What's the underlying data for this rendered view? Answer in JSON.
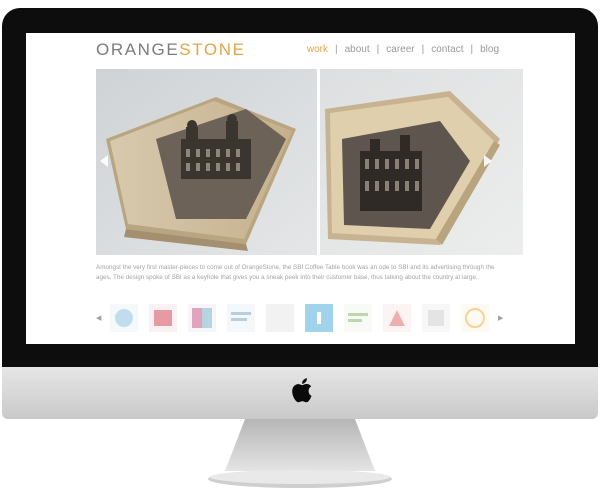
{
  "brand": {
    "part1": "ORANGE",
    "part2": "STONE",
    "accent_color": "#e0a64a"
  },
  "nav": {
    "items": [
      {
        "label": "work",
        "active": true
      },
      {
        "label": "about",
        "active": false
      },
      {
        "label": "career",
        "active": false
      },
      {
        "label": "contact",
        "active": false
      },
      {
        "label": "blog",
        "active": false
      }
    ],
    "separator": "|"
  },
  "slideshow": {
    "prev_icon": "chevron-left-icon",
    "next_icon": "chevron-right-icon"
  },
  "description": "Amongst the very first master-pieces to come out of OrangeStone, the SBI Coffee Table book was an ode to SBI and its advertising through the ages. The design spoke of SBI as a keyhole that gives you a sneak peek into their customer base, thus talking about the country at large.",
  "thumbnails": {
    "prev_glyph": "◀",
    "next_glyph": "▶",
    "items": [
      {
        "icon": "thumbnail-circle-icon",
        "color": "#8fc3e0"
      },
      {
        "icon": "thumbnail-red-cover-icon",
        "color": "#d24a5a"
      },
      {
        "icon": "thumbnail-colorful-icon",
        "color": "#c85a8a"
      },
      {
        "icon": "thumbnail-text-icon",
        "color": "#7fa9c7"
      },
      {
        "icon": "thumbnail-blank-icon",
        "color": "#e8e8e8"
      },
      {
        "icon": "thumbnail-blue-icon",
        "color": "#55b2dd"
      },
      {
        "icon": "thumbnail-green-text-icon",
        "color": "#8ab86a"
      },
      {
        "icon": "thumbnail-red-fold-icon",
        "color": "#e07070"
      },
      {
        "icon": "thumbnail-grey-icon",
        "color": "#cfcfcf"
      },
      {
        "icon": "thumbnail-orange-ring-icon",
        "color": "#f0b040"
      }
    ]
  }
}
